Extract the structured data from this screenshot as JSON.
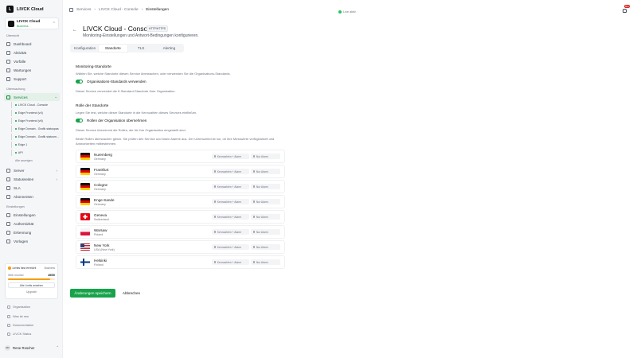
{
  "brand": {
    "name": "LIVCK Cloud"
  },
  "org": {
    "name": "LIVCK Cloud",
    "plan": "Business"
  },
  "nav": {
    "section_overview": "Übersicht",
    "dashboard": "Dashboard",
    "activity": "Aktivität",
    "incidents": "Vorfälle",
    "maintenance": "Wartungen",
    "support": "Support",
    "section_monitoring": "Überwachung",
    "services": "Services",
    "services_children": [
      "LIVCK Cloud - Console",
      "Edge Frontend (v4)",
      "Edge Frontend (v6)",
      "Edge Domain - Grafik statuspas",
      "Edge Domain - Grafik statusm...",
      "Edge 1",
      "API"
    ],
    "services_more": "Alle anzeigen",
    "servers": "Server",
    "status_pages": "Statusseiten",
    "sla": "SLA",
    "subscribers": "Abonnenten",
    "section_settings": "Einstellungen",
    "settings": "Einstellungen",
    "authenticity": "Authentizität",
    "branding": "Erkennung",
    "templates": "Vorlagen"
  },
  "usage": {
    "title": "Limits fast erreicht",
    "badge": "Business",
    "label": "Web monitor",
    "count": "45/50",
    "fraction": 0.9,
    "btn_all": "Alle Limits ansehen",
    "btn_upgrade": "Upgrade"
  },
  "bottom_links": [
    "Organisation",
    "Was ist neu",
    "Dokumentation",
    "LIVCK Status"
  ],
  "user": {
    "name": "Rene Roscher",
    "initials": "RR"
  },
  "breadcrumbs": [
    "Services",
    "LIVCK Cloud - Console",
    "Einstellungen"
  ],
  "live": "Live aktiv",
  "notifications": "99+",
  "page": {
    "title": "LIVCK Cloud - Console",
    "badge": "HTTP/HTTPS",
    "subtitle": "Monitoring-Einstellungen und Antwort-Bedingungen konfigurieren."
  },
  "tabs": [
    "Konfiguration",
    "Standorte",
    "TLS",
    "Alerting"
  ],
  "monitoring_locations": {
    "title": "Monitoring-Standorte",
    "desc": "Wählen Sie, welche Standorte diesen Service überwachen, oder verwenden Sie die Organisations-Standards.",
    "toggle": "Organisations-Standards verwenden",
    "info": "Dieser Service verwendet die 8 Standard-Standorte Ihrer Organisation."
  },
  "location_roles": {
    "title": "Rolle der Standorte",
    "desc": "Legen Sie fest, welche dieser Standorte in die Kennzahlen dieses Services einfließen.",
    "toggle": "Rollen der Organisation übernehmen",
    "info": "Dieser Service übernimmt die Rollen, die für Ihre Organisation eingestellt sind.",
    "explain": "Beide Rollen überwachen gleich. Sie prüfen den Service und lösen Alarme aus. Der Unterschied ist nur, ob ihre Messwerte verfügbarkeit und Antwortzeiten mitbestimmen."
  },
  "role_labels": {
    "primary": "Kennzahlen + Alarm",
    "secondary": "Nur Alarm"
  },
  "locations": [
    {
      "name": "Nuremberg",
      "country": "Germany",
      "flag": "de"
    },
    {
      "name": "Frankfurt",
      "country": "Germany",
      "flag": "de"
    },
    {
      "name": "Cologne",
      "country": "Germany",
      "flag": "de"
    },
    {
      "name": "Enge-Sande",
      "country": "Germany",
      "flag": "de"
    },
    {
      "name": "Geneva",
      "country": "Switzerland",
      "flag": "ch"
    },
    {
      "name": "Warsaw",
      "country": "Poland",
      "flag": "pl"
    },
    {
      "name": "New York",
      "country": "USA (New York)",
      "flag": "us"
    },
    {
      "name": "Helsinki",
      "country": "Finland",
      "flag": "fi"
    }
  ],
  "actions": {
    "save": "Änderungen speichern",
    "cancel": "Abbrechen"
  },
  "colors": {
    "accent": "#16a34a",
    "active_bg": "#e3f1e8",
    "warn": "#f59e0b"
  }
}
